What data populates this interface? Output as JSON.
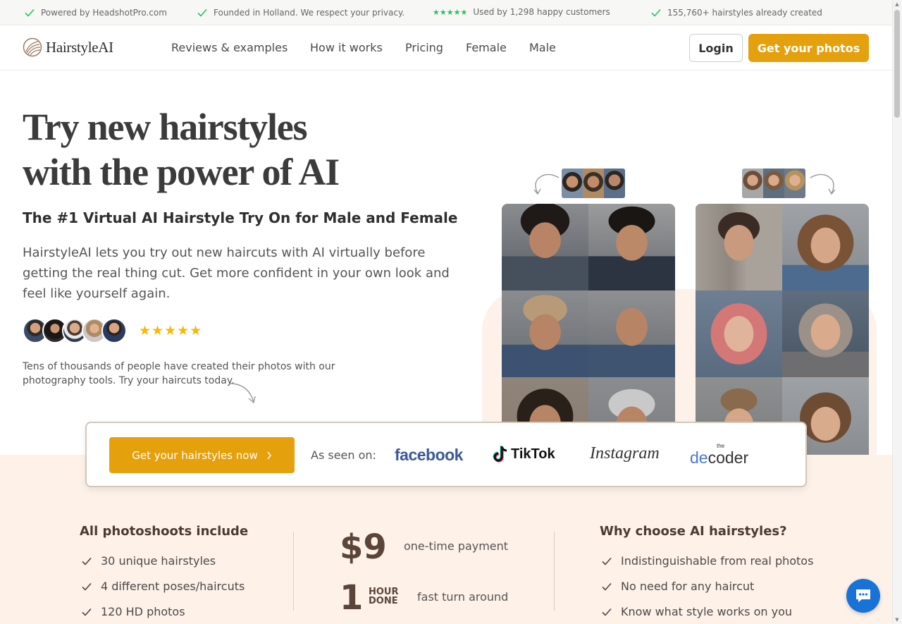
{
  "topbar": {
    "items": [
      "Powered by HeadshotPro.com",
      "Founded in Holland. We respect your privacy.",
      "Used by 1,298 happy customers",
      "155,760+ hairstyles already created"
    ],
    "rating_stars": "★★★★★"
  },
  "nav": {
    "logo_text": "HairstyleAI",
    "links": [
      "Reviews & examples",
      "How it works",
      "Pricing",
      "Female",
      "Male"
    ],
    "login_label": "Login",
    "cta_label": "Get your photos"
  },
  "hero": {
    "title_line1": "Try new hairstyles",
    "title_line2": "with the power of AI",
    "subtitle": "The #1 Virtual AI Hairstyle Try On for Male and Female",
    "description": "HairstyleAI lets you try out new haircuts with AI virtually before getting the real thing cut. Get more confident in your own look and feel like yourself again.",
    "stars": "★★★★★",
    "note": "Tens of thousands of people have created their photos with our photography tools. Try your haircuts today."
  },
  "cta_card": {
    "button_label": "Get your hairstyles now",
    "seen_on": "As seen on:",
    "brands": {
      "facebook": "facebook",
      "tiktok": "TikTok",
      "instagram": "Instagram",
      "decoder_small": "the",
      "decoder_prefix": "de",
      "decoder_suffix": "coder"
    }
  },
  "features": {
    "left_title": "All photoshoots include",
    "left_items": [
      "30 unique hairstyles",
      "4 different poses/haircuts",
      "120 HD photos"
    ],
    "price": "$9",
    "price_note": "one-time payment",
    "hour_num": "1",
    "hour_line1": "HOUR",
    "hour_line2": "DONE",
    "hour_note": "fast turn around",
    "right_title": "Why choose AI hairstyles?",
    "right_items": [
      "Indistinguishable from real photos",
      "No need for any haircut",
      "Know what style works on you"
    ]
  },
  "colors": {
    "accent": "#e5a00d",
    "peach": "#fdf1e8",
    "check_green": "#22c55e",
    "chat_blue": "#1872d8"
  }
}
